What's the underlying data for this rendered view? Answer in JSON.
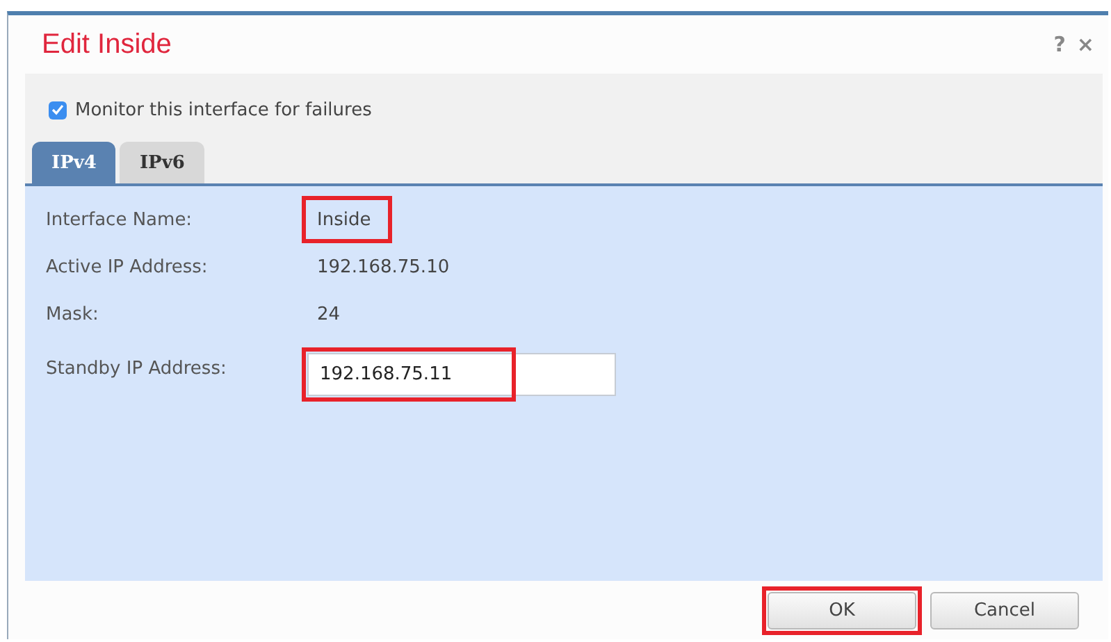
{
  "window": {
    "title": "Edit Inside",
    "help": "?",
    "close": "×"
  },
  "monitor": {
    "label": "Monitor this interface for failures",
    "checked": true
  },
  "tabs": [
    {
      "label": "IPv4",
      "selected": true
    },
    {
      "label": "IPv6",
      "selected": false
    }
  ],
  "fields": [
    {
      "label": "Interface Name:",
      "kind": "text",
      "value": "Inside",
      "highlighted": true
    },
    {
      "label": "Active IP Address:",
      "kind": "text",
      "value": "192.168.75.10",
      "highlighted": false
    },
    {
      "label": "Mask:",
      "kind": "text",
      "value": "24",
      "highlighted": false
    },
    {
      "label": "Standby IP Address:",
      "kind": "input",
      "value": "192.168.75.11",
      "highlighted": true
    }
  ],
  "buttons": [
    {
      "label": "OK",
      "highlighted": true
    },
    {
      "label": "Cancel",
      "highlighted": false
    }
  ]
}
